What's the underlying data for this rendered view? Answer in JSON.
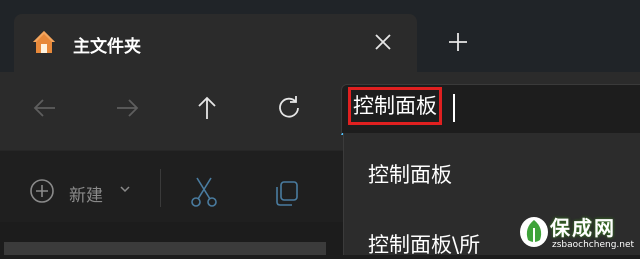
{
  "window": {
    "tab_title": "主文件夹",
    "accent_color": "#4cc2ff",
    "highlight_color": "#e02020"
  },
  "icons": {
    "home": "home-icon",
    "close": "close-icon",
    "new_tab": "plus-icon",
    "back": "arrow-left-icon",
    "forward": "arrow-right-icon",
    "up": "arrow-up-icon",
    "refresh": "refresh-icon",
    "new": "plus-circle-icon",
    "cut": "scissors-icon",
    "copy": "copy-icon"
  },
  "address_bar": {
    "value": "控制面板"
  },
  "suggestions": [
    {
      "label": "控制面板"
    },
    {
      "label": "控制面板\\所"
    }
  ],
  "toolbar": {
    "new_label": "新建"
  },
  "watermark": {
    "title": "保成网",
    "url": "zsbaochcheng.net"
  }
}
